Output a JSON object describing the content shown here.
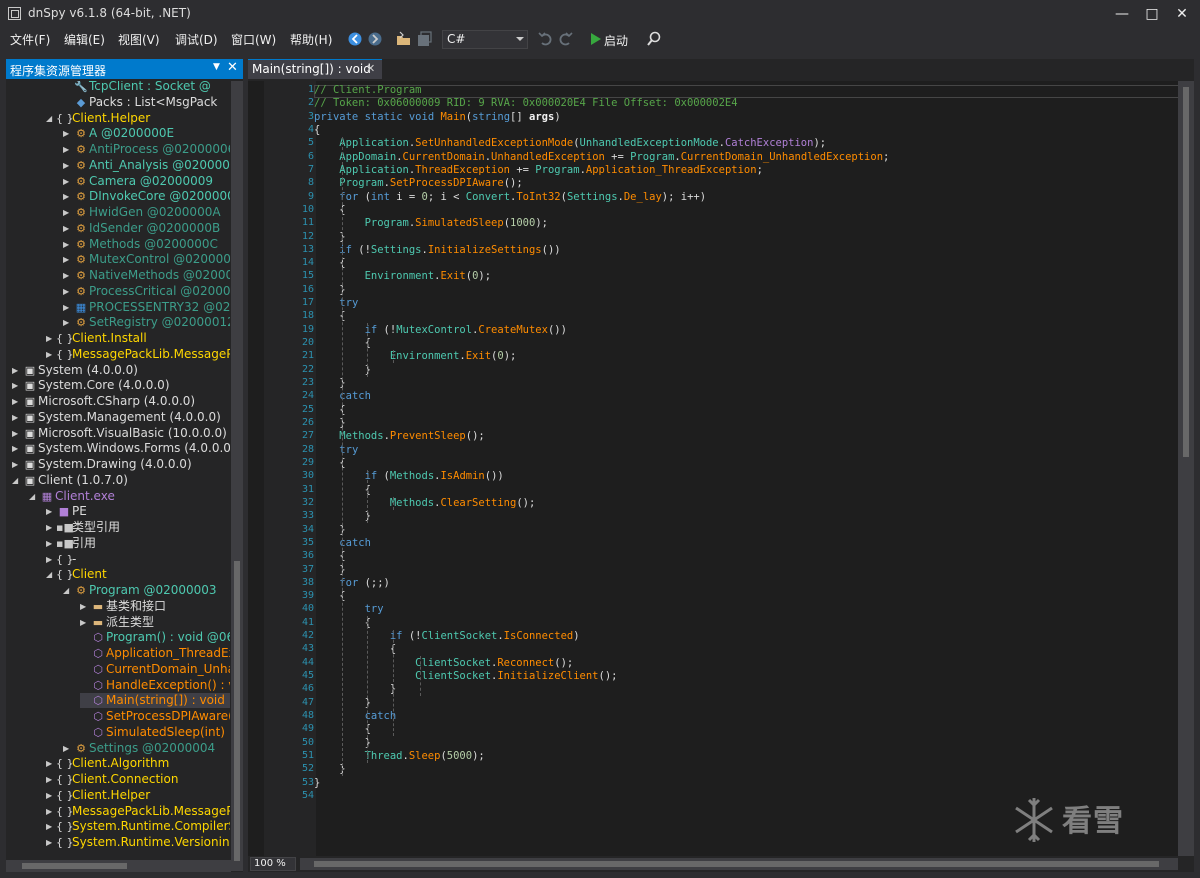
{
  "window": {
    "title": "dnSpy v6.1.8 (64-bit, .NET)"
  },
  "menu": [
    "文件(F)",
    "编辑(E)",
    "视图(V)",
    "调试(D)",
    "窗口(W)",
    "帮助(H)"
  ],
  "toolbar": {
    "language": "C#",
    "run_label": "启动"
  },
  "explorer": {
    "title": "程序集资源管理器",
    "nodes": [
      {
        "t": "TcpClient : Socket @",
        "c": "c-type",
        "i": "wrench-icon"
      },
      {
        "t": "Packs : List<MsgPack",
        "c": "c-white",
        "i": "field-icon"
      },
      {
        "t": "Client.Helper",
        "c": "c-ns",
        "i": "namespace-icon"
      },
      {
        "t": "A @0200000E",
        "c": "c-type",
        "i": "class-icon"
      },
      {
        "t": "AntiProcess @02000006",
        "c": "c-typegray",
        "i": "class-icon"
      },
      {
        "t": "Anti_Analysis @0200000",
        "c": "c-type",
        "i": "class-icon"
      },
      {
        "t": "Camera @02000009",
        "c": "c-type",
        "i": "class-icon"
      },
      {
        "t": "DInvokeCore @0200000",
        "c": "c-type",
        "i": "class-icon"
      },
      {
        "t": "HwidGen @0200000A",
        "c": "c-typegray",
        "i": "class-icon"
      },
      {
        "t": "IdSender @0200000B",
        "c": "c-typegray",
        "i": "class-icon"
      },
      {
        "t": "Methods @0200000C",
        "c": "c-typegray",
        "i": "class-icon"
      },
      {
        "t": "MutexControl @020000",
        "c": "c-typegray",
        "i": "class-icon"
      },
      {
        "t": "NativeMethods @02000",
        "c": "c-typegray",
        "i": "class-icon"
      },
      {
        "t": "ProcessCritical @02000",
        "c": "c-typegray",
        "i": "class-icon"
      },
      {
        "t": "PROCESSENTRY32 @020",
        "c": "c-typegray",
        "i": "struct-icon"
      },
      {
        "t": "SetRegistry @02000012",
        "c": "c-typegray",
        "i": "class-icon"
      },
      {
        "t": "Client.Install",
        "c": "c-ns",
        "i": "namespace-icon"
      },
      {
        "t": "MessagePackLib.MessageP",
        "c": "c-ns",
        "i": "namespace-icon"
      },
      {
        "t": "System (4.0.0.0)",
        "c": "c-white",
        "i": "assembly-icon"
      },
      {
        "t": "System.Core (4.0.0.0)",
        "c": "c-white",
        "i": "assembly-icon"
      },
      {
        "t": "Microsoft.CSharp (4.0.0.0)",
        "c": "c-white",
        "i": "assembly-icon"
      },
      {
        "t": "System.Management (4.0.0.0)",
        "c": "c-white",
        "i": "assembly-icon"
      },
      {
        "t": "Microsoft.VisualBasic (10.0.0.0)",
        "c": "c-white",
        "i": "assembly-icon"
      },
      {
        "t": "System.Windows.Forms (4.0.0.0)",
        "c": "c-white",
        "i": "assembly-icon"
      },
      {
        "t": "System.Drawing (4.0.0.0)",
        "c": "c-white",
        "i": "assembly-icon"
      },
      {
        "t": "Client (1.0.7.0)",
        "c": "c-white",
        "i": "assembly-icon"
      },
      {
        "t": "Client.exe",
        "c": "c-purple",
        "i": "module-icon"
      },
      {
        "t": "PE",
        "c": "c-white",
        "i": "pe-icon"
      },
      {
        "t": "类型引用",
        "c": "c-white",
        "i": "typeref-icon"
      },
      {
        "t": "引用",
        "c": "c-white",
        "i": "reference-icon"
      },
      {
        "t": "-",
        "c": "c-white",
        "i": "namespace-icon"
      },
      {
        "t": "Client",
        "c": "c-ns",
        "i": "namespace-icon"
      },
      {
        "t": "Program @02000003",
        "c": "c-type",
        "i": "class-icon"
      },
      {
        "t": "基类和接口",
        "c": "c-white",
        "i": "folder-icon"
      },
      {
        "t": "派生类型",
        "c": "c-white",
        "i": "folder-icon"
      },
      {
        "t": "Program() : void @06",
        "c": "c-type",
        "i": "method-icon"
      },
      {
        "t": "Application_ThreadEx",
        "c": "c-orange",
        "i": "method-icon"
      },
      {
        "t": "CurrentDomain_Unha",
        "c": "c-orange",
        "i": "method-icon"
      },
      {
        "t": "HandleException() : v",
        "c": "c-orange",
        "i": "method-icon"
      },
      {
        "t": "Main(string[]) : void",
        "c": "c-orange",
        "i": "method-icon"
      },
      {
        "t": "SetProcessDPIAware(",
        "c": "c-orange",
        "i": "method-icon"
      },
      {
        "t": "SimulatedSleep(int) :",
        "c": "c-orange",
        "i": "method-icon"
      },
      {
        "t": "Settings @02000004",
        "c": "c-typegray",
        "i": "class-icon"
      },
      {
        "t": "Client.Algorithm",
        "c": "c-ns",
        "i": "namespace-icon"
      },
      {
        "t": "Client.Connection",
        "c": "c-ns",
        "i": "namespace-icon"
      },
      {
        "t": "Client.Helper",
        "c": "c-ns",
        "i": "namespace-icon"
      },
      {
        "t": "MessagePackLib.MessageP",
        "c": "c-ns",
        "i": "namespace-icon"
      },
      {
        "t": "System.Runtime.CompilerSe",
        "c": "c-ns",
        "i": "namespace-icon"
      },
      {
        "t": "System.Runtime.Versioning",
        "c": "c-ns",
        "i": "namespace-icon"
      }
    ]
  },
  "editor": {
    "tab_label": "Main(string[]) : void",
    "zoom": "100 %",
    "lines": [
      "// Client.Program",
      "// Token: 0x06000009 RID: 9 RVA: 0x000020E4 File Offset: 0x000002E4",
      "private static void Main(string[] args)",
      "{",
      "    Application.SetUnhandledExceptionMode(UnhandledExceptionMode.CatchException);",
      "    AppDomain.CurrentDomain.UnhandledException += Program.CurrentDomain_UnhandledException;",
      "    Application.ThreadException += Program.Application_ThreadException;",
      "    Program.SetProcessDPIAware();",
      "    for (int i = 0; i < Convert.ToInt32(Settings.De_lay); i++)",
      "    {",
      "        Program.SimulatedSleep(1000);",
      "    }",
      "    if (!Settings.InitializeSettings())",
      "    {",
      "        Environment.Exit(0);",
      "    }",
      "    try",
      "    {",
      "        if (!MutexControl.CreateMutex())",
      "        {",
      "            Environment.Exit(0);",
      "        }",
      "    }",
      "    catch",
      "    {",
      "    }",
      "    Methods.PreventSleep();",
      "    try",
      "    {",
      "        if (Methods.IsAdmin())",
      "        {",
      "            Methods.ClearSetting();",
      "        }",
      "    }",
      "    catch",
      "    {",
      "    }",
      "    for (;;)",
      "    {",
      "        try",
      "        {",
      "            if (!ClientSocket.IsConnected)",
      "            {",
      "                ClientSocket.Reconnect();",
      "                ClientSocket.InitializeClient();",
      "            }",
      "        }",
      "        catch",
      "        {",
      "        }",
      "        Thread.Sleep(5000);",
      "    }",
      "}",
      ""
    ]
  },
  "watermark": {
    "text": "看雪"
  }
}
